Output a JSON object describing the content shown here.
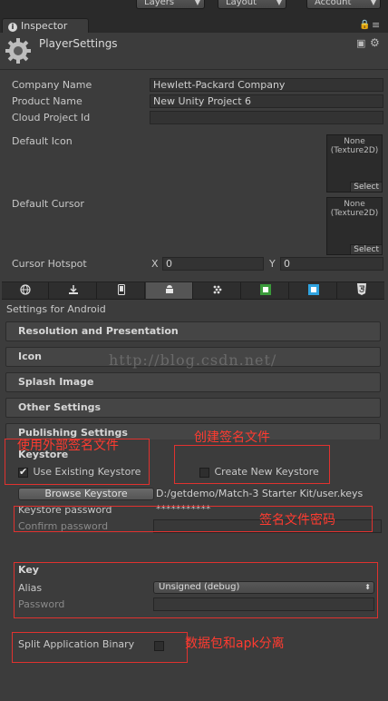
{
  "toolbar": {
    "layers": "Layers",
    "layout": "Layout",
    "account": "Account"
  },
  "window": {
    "tab": "Inspector",
    "info_glyph": "i",
    "title": "PlayerSettings"
  },
  "fields": {
    "company_label": "Company Name",
    "company_value": "Hewlett-Packard Company",
    "product_label": "Product Name",
    "product_value": "New Unity Project 6",
    "cloud_label": "Cloud Project Id",
    "cloud_value": "",
    "icon_label": "Default Icon",
    "cursor_label": "Default Cursor",
    "object_none": "None",
    "object_type": "(Texture2D)",
    "object_select": "Select",
    "hotspot_label": "Cursor Hotspot",
    "x_label": "X",
    "x_value": "0",
    "y_label": "Y",
    "y_value": "0"
  },
  "platform_heading": "Settings for Android",
  "sections": {
    "resolution": "Resolution and Presentation",
    "icon": "Icon",
    "splash": "Splash Image",
    "other": "Other Settings",
    "publishing": "Publishing Settings"
  },
  "keystore": {
    "heading": "Keystore",
    "use_existing": "Use Existing Keystore",
    "create_new": "Create New Keystore",
    "browse": "Browse Keystore",
    "path": "D:/getdemo/Match-3 Starter Kit/user.keys",
    "password_label": "Keystore password",
    "password_value": "***********",
    "confirm_label": "Confirm password"
  },
  "key": {
    "heading": "Key",
    "alias_label": "Alias",
    "alias_value": "Unsigned (debug)",
    "password_label": "Password"
  },
  "split_label": "Split Application Binary",
  "watermark": "http://blog.csdn.net/",
  "annotations": {
    "use_external": "使用外部签名文件",
    "create_file": "创建签名文件",
    "keystore_pwd": "签名文件密码",
    "split_apk": "数据包和apk分离"
  },
  "colors": {
    "annotation": "#ff3b30",
    "background": "#3c3c3c"
  }
}
